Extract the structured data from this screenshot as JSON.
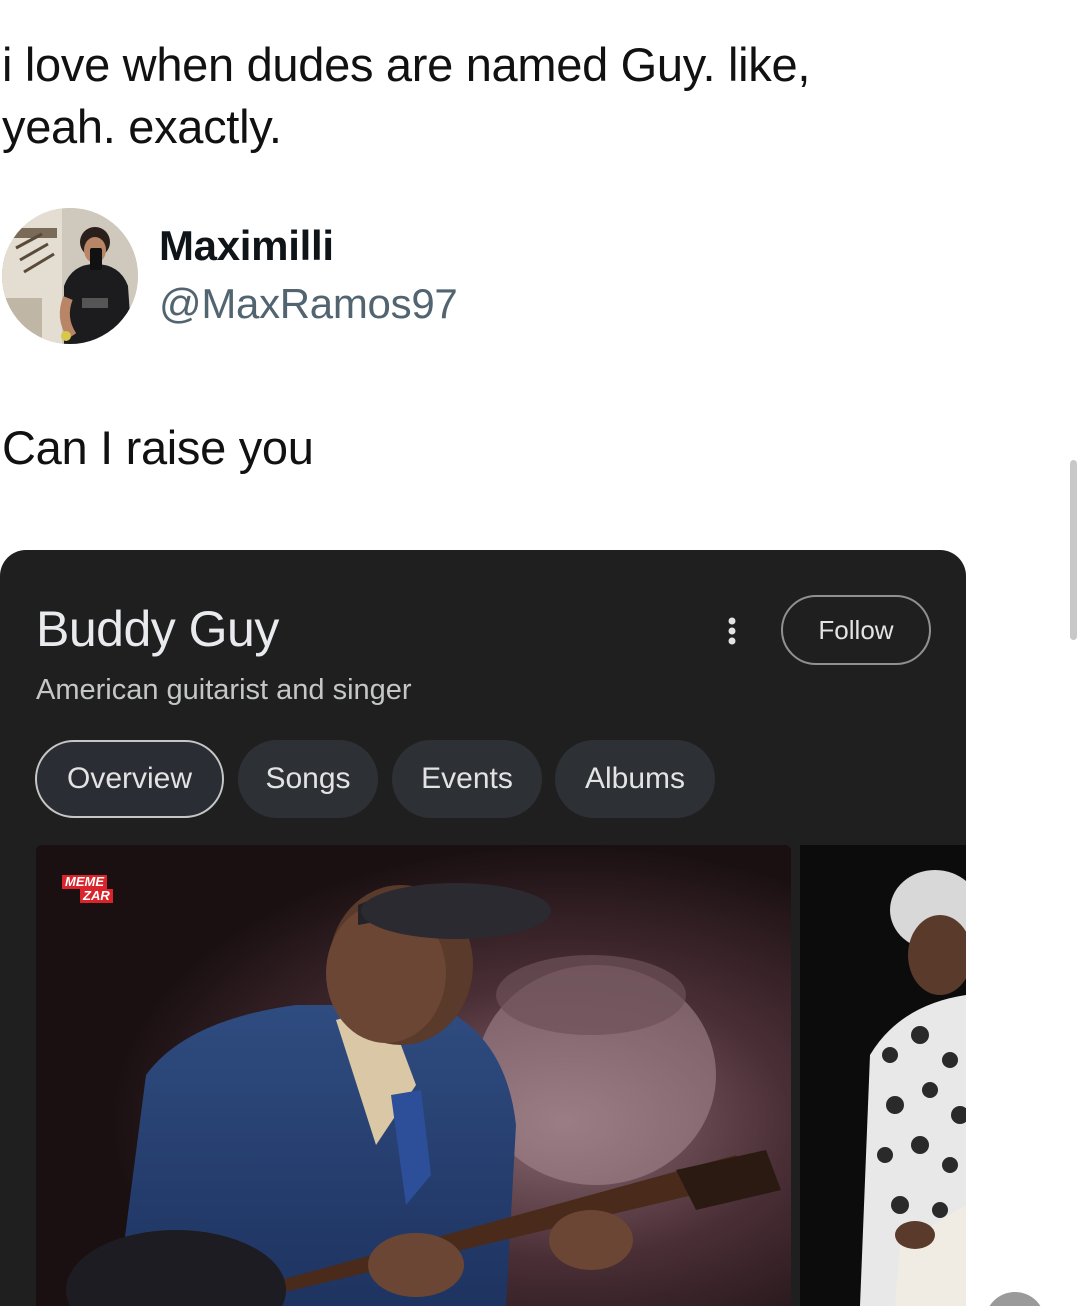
{
  "tweet": {
    "text_line1": "i love when dudes are named Guy. like,",
    "text_line2": "yeah. exactly."
  },
  "reply": {
    "display_name": "Maximilli",
    "handle": "@MaxRamos97",
    "text": "Can I raise you"
  },
  "knowledge_card": {
    "title": "Buddy Guy",
    "subtitle": "American guitarist and singer",
    "follow_label": "Follow",
    "more_icon": "more-vert-icon",
    "tabs": [
      {
        "label": "Overview",
        "active": true
      },
      {
        "label": "Songs",
        "active": false
      },
      {
        "label": "Events",
        "active": false
      },
      {
        "label": "Albums",
        "active": false
      }
    ],
    "watermark_line1": "MEME",
    "watermark_line2": "ZAR"
  },
  "colors": {
    "card_bg": "#1f1f1f",
    "chip_bg": "#2d3035",
    "handle": "#536471",
    "watermark_red": "#d9242b"
  }
}
